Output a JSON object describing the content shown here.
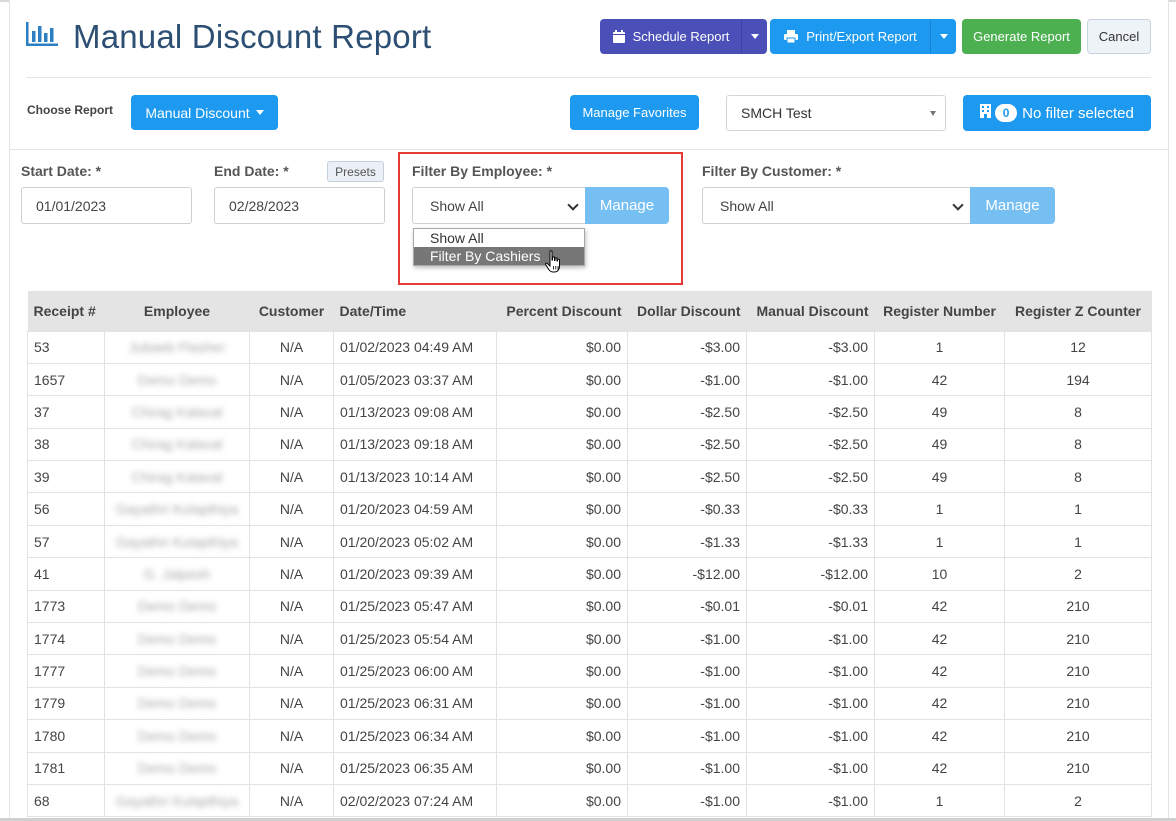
{
  "header": {
    "title": "Manual Discount Report",
    "buttons": {
      "schedule": "Schedule Report",
      "print": "Print/Export Report",
      "generate": "Generate Report",
      "cancel": "Cancel"
    }
  },
  "toolbar": {
    "choose_label": "Choose Report",
    "report_button": "Manual Discount",
    "favorites_button": "Manage Favorites",
    "store_select_value": "SMCH Test",
    "filter_badge_count": "0",
    "filter_button": "No filter selected"
  },
  "filters": {
    "start_date_label": "Start Date: *",
    "start_date_value": "01/01/2023",
    "end_date_label": "End Date: *",
    "end_date_value": "02/28/2023",
    "presets_button": "Presets",
    "employee_label": "Filter By Employee: *",
    "employee_value": "Show All",
    "employee_manage": "Manage",
    "employee_options": [
      "Show All",
      "Filter By Cashiers"
    ],
    "customer_label": "Filter By Customer: *",
    "customer_value": "Show All",
    "customer_manage": "Manage"
  },
  "table": {
    "columns": [
      "Receipt #",
      "Employee",
      "Customer",
      "Date/Time",
      "Percent Discount",
      "Dollar Discount",
      "Manual Discount",
      "Register Number",
      "Register Z Counter"
    ],
    "rows": [
      [
        "53",
        "Jubaeb Flasher",
        "N/A",
        "01/02/2023 04:49 AM",
        "$0.00",
        "-$3.00",
        "-$3.00",
        "1",
        "12"
      ],
      [
        "1657",
        "Demo Demo",
        "N/A",
        "01/05/2023 03:37 AM",
        "$0.00",
        "-$1.00",
        "-$1.00",
        "42",
        "194"
      ],
      [
        "37",
        "Chirag Kalaval",
        "N/A",
        "01/13/2023 09:08 AM",
        "$0.00",
        "-$2.50",
        "-$2.50",
        "49",
        "8"
      ],
      [
        "38",
        "Chirag Kalaval",
        "N/A",
        "01/13/2023 09:18 AM",
        "$0.00",
        "-$2.50",
        "-$2.50",
        "49",
        "8"
      ],
      [
        "39",
        "Chirag Kalaval",
        "N/A",
        "01/13/2023 10:14 AM",
        "$0.00",
        "-$2.50",
        "-$2.50",
        "49",
        "8"
      ],
      [
        "56",
        "Gayathri Kulapthiya",
        "N/A",
        "01/20/2023 04:59 AM",
        "$0.00",
        "-$0.33",
        "-$0.33",
        "1",
        "1"
      ],
      [
        "57",
        "Gayathri Kulapthiya",
        "N/A",
        "01/20/2023 05:02 AM",
        "$0.00",
        "-$1.33",
        "-$1.33",
        "1",
        "1"
      ],
      [
        "41",
        "G. Jalpesh",
        "N/A",
        "01/20/2023 09:39 AM",
        "$0.00",
        "-$12.00",
        "-$12.00",
        "10",
        "2"
      ],
      [
        "1773",
        "Demo Demo",
        "N/A",
        "01/25/2023 05:47 AM",
        "$0.00",
        "-$0.01",
        "-$0.01",
        "42",
        "210"
      ],
      [
        "1774",
        "Demo Demo",
        "N/A",
        "01/25/2023 05:54 AM",
        "$0.00",
        "-$1.00",
        "-$1.00",
        "42",
        "210"
      ],
      [
        "1777",
        "Demo Demo",
        "N/A",
        "01/25/2023 06:00 AM",
        "$0.00",
        "-$1.00",
        "-$1.00",
        "42",
        "210"
      ],
      [
        "1779",
        "Demo Demo",
        "N/A",
        "01/25/2023 06:31 AM",
        "$0.00",
        "-$1.00",
        "-$1.00",
        "42",
        "210"
      ],
      [
        "1780",
        "Demo Demo",
        "N/A",
        "01/25/2023 06:34 AM",
        "$0.00",
        "-$1.00",
        "-$1.00",
        "42",
        "210"
      ],
      [
        "1781",
        "Demo Demo",
        "N/A",
        "01/25/2023 06:35 AM",
        "$0.00",
        "-$1.00",
        "-$1.00",
        "42",
        "210"
      ],
      [
        "68",
        "Gayathri Kulapthiya",
        "N/A",
        "02/02/2023 07:24 AM",
        "$0.00",
        "-$1.00",
        "-$1.00",
        "1",
        "2"
      ]
    ]
  },
  "colors": {
    "title": "#2d4f73",
    "schedule": "#4a50b8",
    "primary": "#1d99f0",
    "generate": "#4caf50",
    "manage": "#75bff3",
    "highlight": "#e53935"
  },
  "icons": {
    "title": "bar-chart-icon",
    "schedule": "calendar-icon",
    "print": "printer-icon",
    "filter": "building-icon",
    "cursor": "hand-pointer-icon"
  }
}
